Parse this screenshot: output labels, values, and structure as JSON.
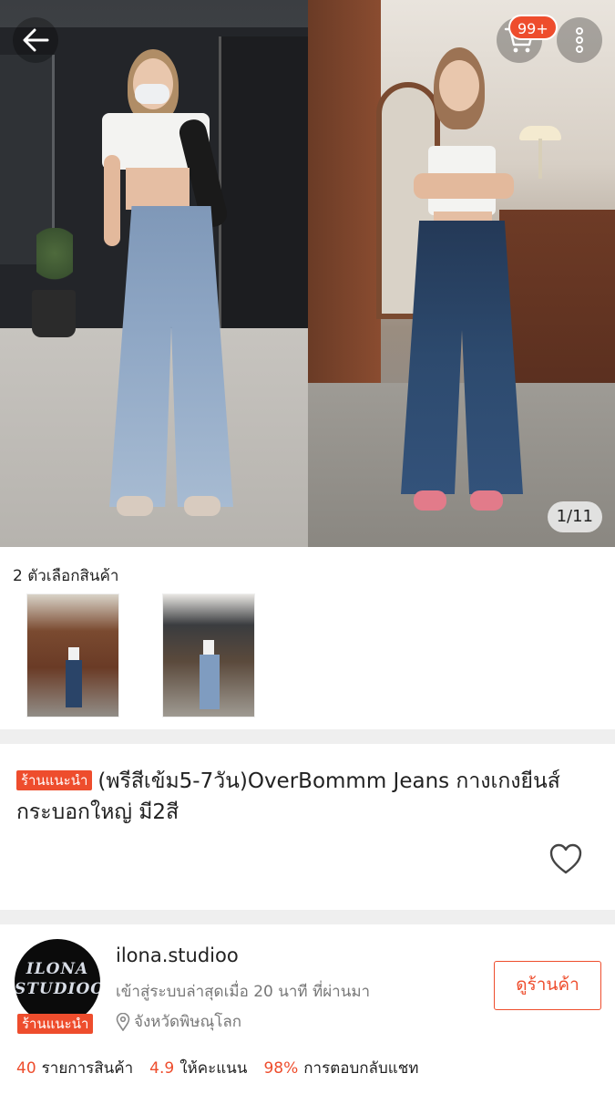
{
  "hero": {
    "image_alt": "",
    "counter": "1/11"
  },
  "topbar": {
    "back_icon": "arrow-left-icon",
    "cart_icon": "cart-icon",
    "cart_badge": "99+",
    "more_icon": "more-vertical-icon"
  },
  "variants": {
    "label": "2 ตัวเลือกสินค้า",
    "items": [
      {
        "name": "dark-wash"
      },
      {
        "name": "light-wash"
      }
    ]
  },
  "product": {
    "badge": "ร้านแนะนำ",
    "title": "(พรีสีเข้ม5-7วัน)OverBommm Jeans กางเกงยีนส์กระบอกใหญ่ มี2สี",
    "favorite_icon": "heart-outline-icon"
  },
  "shop": {
    "logo_text_line1": "ILONA",
    "logo_text_line2": "STUDIOO",
    "badge": "ร้านแนะนำ",
    "name": "ilona.studioo",
    "last_active": "เข้าสู่ระบบล่าสุดเมื่อ 20 นาที ที่ผ่านมา",
    "location": "จังหวัดพิษณุโลก",
    "visit_button": "ดูร้านค้า",
    "stats": [
      {
        "value": "40",
        "label": "รายการสินค้า"
      },
      {
        "value": "4.9",
        "label": "ให้คะแนน"
      },
      {
        "value": "98%",
        "label": "การตอบกลับแชท"
      }
    ]
  },
  "colors": {
    "accent": "#ee4d2d",
    "divider": "#efefef",
    "muted_text": "#777777"
  }
}
